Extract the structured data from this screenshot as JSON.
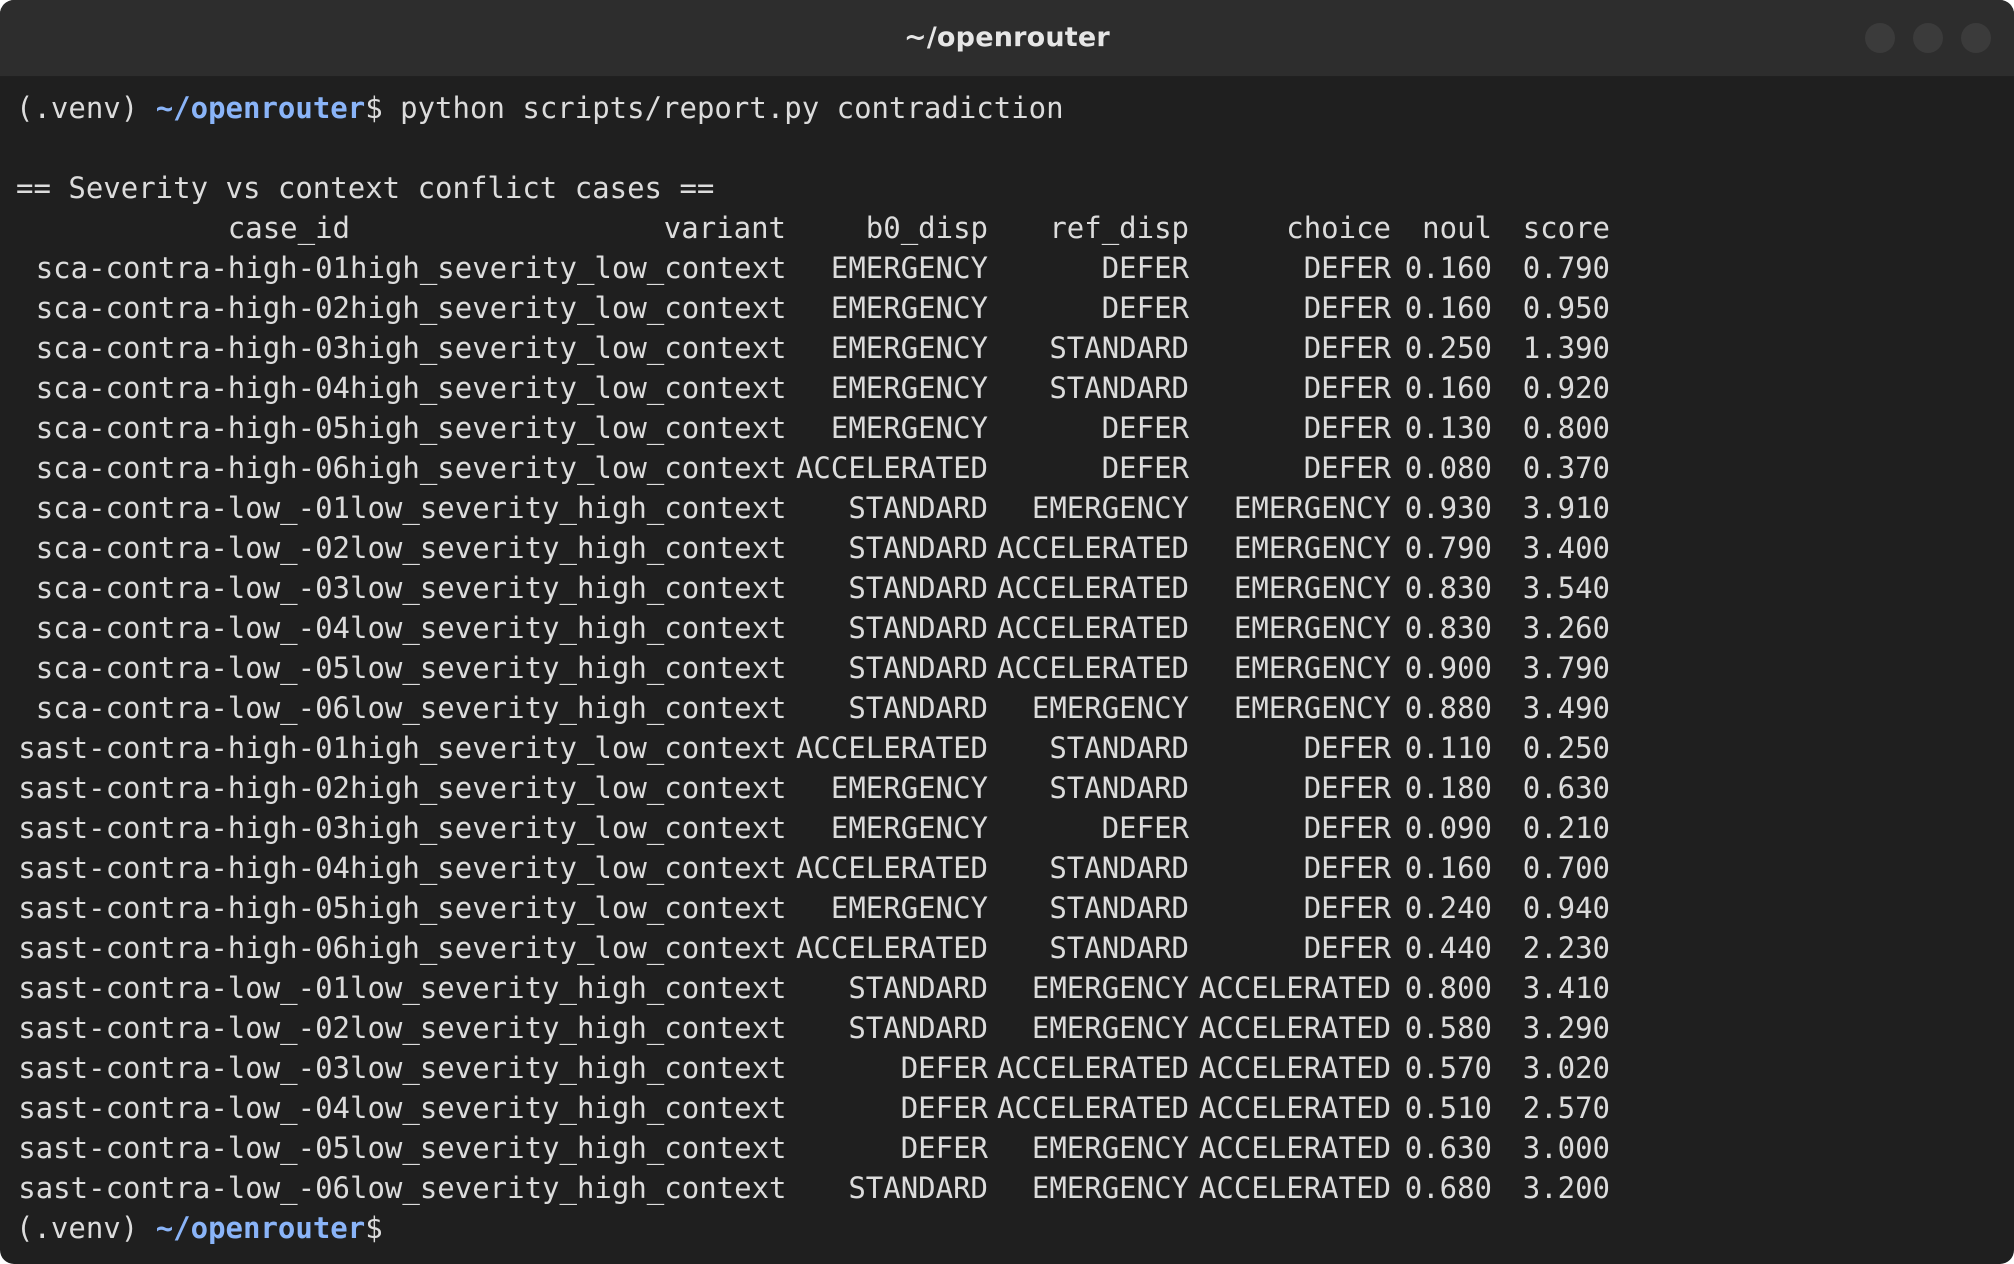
{
  "window": {
    "title": "~/openrouter"
  },
  "terminal": {
    "command_prompt": {
      "venv": "(.venv)",
      "path": "~/openrouter",
      "symbol": "$",
      "command": "python scripts/report.py contradiction"
    },
    "section_title": "== Severity vs context conflict cases ==",
    "table": {
      "headers": {
        "case_id": "case_id",
        "variant": "variant",
        "b0_disp": "b0_disp",
        "ref_disp": "ref_disp",
        "choice": "choice",
        "noul": "noul",
        "score": "score"
      },
      "rows": [
        {
          "case_id": "sca-contra-high-01",
          "variant": "high_severity_low_context",
          "b0_disp": "EMERGENCY",
          "ref_disp": "DEFER",
          "choice": "DEFER",
          "noul": "0.160",
          "score": "0.790"
        },
        {
          "case_id": "sca-contra-high-02",
          "variant": "high_severity_low_context",
          "b0_disp": "EMERGENCY",
          "ref_disp": "DEFER",
          "choice": "DEFER",
          "noul": "0.160",
          "score": "0.950"
        },
        {
          "case_id": "sca-contra-high-03",
          "variant": "high_severity_low_context",
          "b0_disp": "EMERGENCY",
          "ref_disp": "STANDARD",
          "choice": "DEFER",
          "noul": "0.250",
          "score": "1.390"
        },
        {
          "case_id": "sca-contra-high-04",
          "variant": "high_severity_low_context",
          "b0_disp": "EMERGENCY",
          "ref_disp": "STANDARD",
          "choice": "DEFER",
          "noul": "0.160",
          "score": "0.920"
        },
        {
          "case_id": "sca-contra-high-05",
          "variant": "high_severity_low_context",
          "b0_disp": "EMERGENCY",
          "ref_disp": "DEFER",
          "choice": "DEFER",
          "noul": "0.130",
          "score": "0.800"
        },
        {
          "case_id": "sca-contra-high-06",
          "variant": "high_severity_low_context",
          "b0_disp": "ACCELERATED",
          "ref_disp": "DEFER",
          "choice": "DEFER",
          "noul": "0.080",
          "score": "0.370"
        },
        {
          "case_id": "sca-contra-low_-01",
          "variant": "low_severity_high_context",
          "b0_disp": "STANDARD",
          "ref_disp": "EMERGENCY",
          "choice": "EMERGENCY",
          "noul": "0.930",
          "score": "3.910"
        },
        {
          "case_id": "sca-contra-low_-02",
          "variant": "low_severity_high_context",
          "b0_disp": "STANDARD",
          "ref_disp": "ACCELERATED",
          "choice": "EMERGENCY",
          "noul": "0.790",
          "score": "3.400"
        },
        {
          "case_id": "sca-contra-low_-03",
          "variant": "low_severity_high_context",
          "b0_disp": "STANDARD",
          "ref_disp": "ACCELERATED",
          "choice": "EMERGENCY",
          "noul": "0.830",
          "score": "3.540"
        },
        {
          "case_id": "sca-contra-low_-04",
          "variant": "low_severity_high_context",
          "b0_disp": "STANDARD",
          "ref_disp": "ACCELERATED",
          "choice": "EMERGENCY",
          "noul": "0.830",
          "score": "3.260"
        },
        {
          "case_id": "sca-contra-low_-05",
          "variant": "low_severity_high_context",
          "b0_disp": "STANDARD",
          "ref_disp": "ACCELERATED",
          "choice": "EMERGENCY",
          "noul": "0.900",
          "score": "3.790"
        },
        {
          "case_id": "sca-contra-low_-06",
          "variant": "low_severity_high_context",
          "b0_disp": "STANDARD",
          "ref_disp": "EMERGENCY",
          "choice": "EMERGENCY",
          "noul": "0.880",
          "score": "3.490"
        },
        {
          "case_id": "sast-contra-high-01",
          "variant": "high_severity_low_context",
          "b0_disp": "ACCELERATED",
          "ref_disp": "STANDARD",
          "choice": "DEFER",
          "noul": "0.110",
          "score": "0.250"
        },
        {
          "case_id": "sast-contra-high-02",
          "variant": "high_severity_low_context",
          "b0_disp": "EMERGENCY",
          "ref_disp": "STANDARD",
          "choice": "DEFER",
          "noul": "0.180",
          "score": "0.630"
        },
        {
          "case_id": "sast-contra-high-03",
          "variant": "high_severity_low_context",
          "b0_disp": "EMERGENCY",
          "ref_disp": "DEFER",
          "choice": "DEFER",
          "noul": "0.090",
          "score": "0.210"
        },
        {
          "case_id": "sast-contra-high-04",
          "variant": "high_severity_low_context",
          "b0_disp": "ACCELERATED",
          "ref_disp": "STANDARD",
          "choice": "DEFER",
          "noul": "0.160",
          "score": "0.700"
        },
        {
          "case_id": "sast-contra-high-05",
          "variant": "high_severity_low_context",
          "b0_disp": "EMERGENCY",
          "ref_disp": "STANDARD",
          "choice": "DEFER",
          "noul": "0.240",
          "score": "0.940"
        },
        {
          "case_id": "sast-contra-high-06",
          "variant": "high_severity_low_context",
          "b0_disp": "ACCELERATED",
          "ref_disp": "STANDARD",
          "choice": "DEFER",
          "noul": "0.440",
          "score": "2.230"
        },
        {
          "case_id": "sast-contra-low_-01",
          "variant": "low_severity_high_context",
          "b0_disp": "STANDARD",
          "ref_disp": "EMERGENCY",
          "choice": "ACCELERATED",
          "noul": "0.800",
          "score": "3.410"
        },
        {
          "case_id": "sast-contra-low_-02",
          "variant": "low_severity_high_context",
          "b0_disp": "STANDARD",
          "ref_disp": "EMERGENCY",
          "choice": "ACCELERATED",
          "noul": "0.580",
          "score": "3.290"
        },
        {
          "case_id": "sast-contra-low_-03",
          "variant": "low_severity_high_context",
          "b0_disp": "DEFER",
          "ref_disp": "ACCELERATED",
          "choice": "ACCELERATED",
          "noul": "0.570",
          "score": "3.020"
        },
        {
          "case_id": "sast-contra-low_-04",
          "variant": "low_severity_high_context",
          "b0_disp": "DEFER",
          "ref_disp": "ACCELERATED",
          "choice": "ACCELERATED",
          "noul": "0.510",
          "score": "2.570"
        },
        {
          "case_id": "sast-contra-low_-05",
          "variant": "low_severity_high_context",
          "b0_disp": "DEFER",
          "ref_disp": "EMERGENCY",
          "choice": "ACCELERATED",
          "noul": "0.630",
          "score": "3.000"
        },
        {
          "case_id": "sast-contra-low_-06",
          "variant": "low_severity_high_context",
          "b0_disp": "STANDARD",
          "ref_disp": "EMERGENCY",
          "choice": "ACCELERATED",
          "noul": "0.680",
          "score": "3.200"
        }
      ]
    },
    "final_prompt": {
      "venv": "(.venv)",
      "path": "~/openrouter",
      "symbol": "$"
    }
  }
}
